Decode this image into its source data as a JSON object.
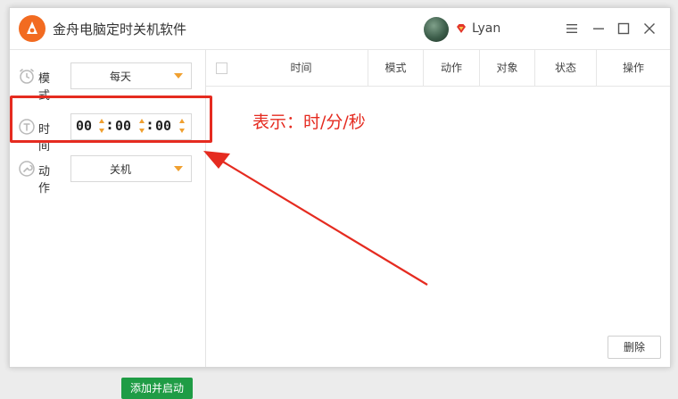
{
  "window": {
    "title": "金舟电脑定时关机软件",
    "user": {
      "name": "Lyan",
      "avatar_icon": "avatar",
      "badge_icon": "vip-diamond-icon"
    },
    "controls": [
      "menu-icon",
      "minimize-icon",
      "maximize-icon",
      "close-icon"
    ]
  },
  "left_panel": {
    "mode": {
      "label": "模式",
      "icon": "alarm-clock-icon",
      "value": "每天"
    },
    "time": {
      "label": "时间",
      "icon": "timer-icon",
      "hour": "00",
      "minute": "00",
      "second": "00"
    },
    "action": {
      "label": "动作",
      "icon": "wrench-icon",
      "value": "关机"
    },
    "add_button": "添加并启动"
  },
  "table": {
    "columns": [
      "时间",
      "模式",
      "动作",
      "对象",
      "状态",
      "操作"
    ],
    "rows": []
  },
  "annotation": {
    "text": "表示：时/分/秒",
    "color": "#e52b20"
  },
  "delete_button": "删除",
  "colors": {
    "accent": "#f0a030",
    "primary_button": "#1f9c45",
    "highlight": "#e52b20",
    "logo": "#f26b21"
  }
}
